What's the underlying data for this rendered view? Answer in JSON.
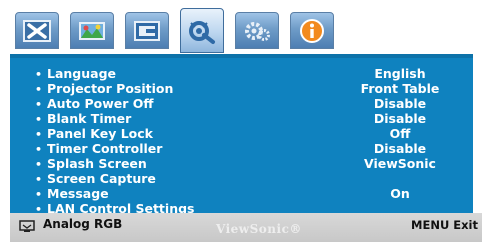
{
  "tabs": [
    {
      "name": "picture-icon"
    },
    {
      "name": "color-icon"
    },
    {
      "name": "display-icon"
    },
    {
      "name": "setup-icon",
      "active": true
    },
    {
      "name": "advanced-icon"
    },
    {
      "name": "information-icon"
    }
  ],
  "menu": {
    "items": [
      {
        "label": "Language",
        "value": "English"
      },
      {
        "label": "Projector Position",
        "value": "Front Table"
      },
      {
        "label": "Auto Power Off",
        "value": "Disable"
      },
      {
        "label": "Blank Timer",
        "value": "Disable"
      },
      {
        "label": "Panel Key Lock",
        "value": "Off"
      },
      {
        "label": "Timer Controller",
        "value": "Disable"
      },
      {
        "label": "Splash Screen",
        "value": "ViewSonic"
      },
      {
        "label": "Screen Capture",
        "value": ""
      },
      {
        "label": "Message",
        "value": "On"
      },
      {
        "label": "LAN Control Settings",
        "value": ""
      }
    ],
    "bullet": "•"
  },
  "footer": {
    "source_label": "Analog RGB",
    "brand": "ViewSonic®",
    "exit_label": "MENU Exit"
  },
  "colors": {
    "menu_background": "#0f82bf",
    "text": "#ffffff",
    "footer_background": "#d0d0d0"
  }
}
